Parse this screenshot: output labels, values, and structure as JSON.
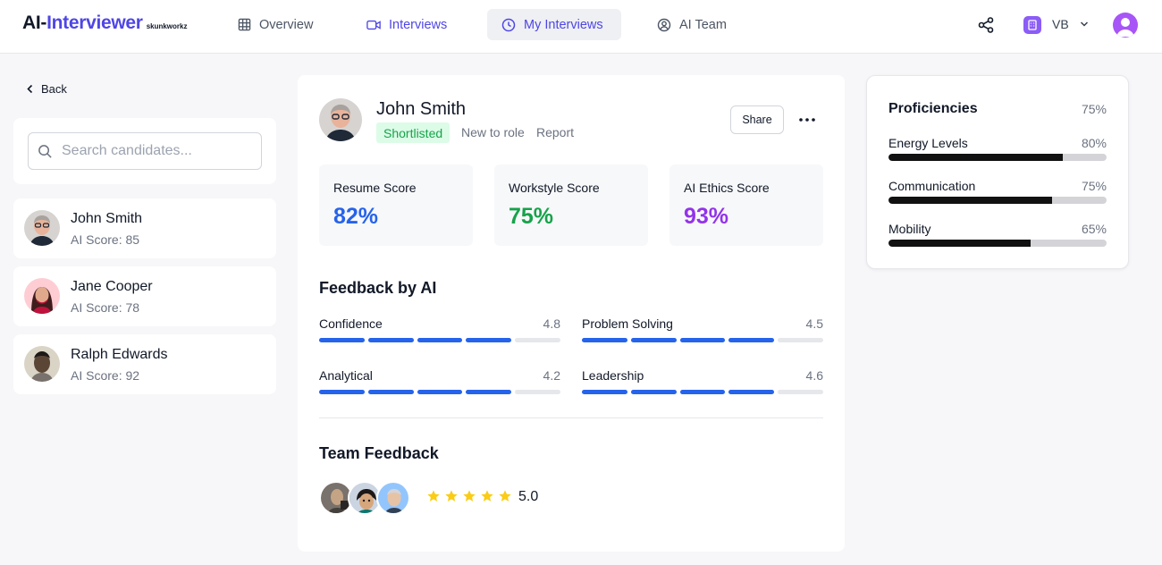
{
  "header": {
    "logo_part1": "AI-",
    "logo_part2": "Interviewer",
    "logo_sub": "skunkworkz",
    "nav": [
      {
        "label": "Overview",
        "icon": "grid-icon"
      },
      {
        "label": "Interviews",
        "icon": "video-icon"
      },
      {
        "label": "My Interviews",
        "icon": "clock-icon"
      },
      {
        "label": "AI Team",
        "icon": "user-circle-icon"
      }
    ],
    "org_label": "VB"
  },
  "sidebar": {
    "back_label": "Back",
    "search_placeholder": "Search candidates...",
    "candidates": [
      {
        "name": "John Smith",
        "score": "AI Score: 85"
      },
      {
        "name": "Jane Cooper",
        "score": "AI Score: 78"
      },
      {
        "name": "Ralph Edwards",
        "score": "AI Score: 92"
      }
    ]
  },
  "candidate": {
    "name": "John Smith",
    "status": "Shortlisted",
    "tag1": "New to role",
    "tag2": "Report",
    "share_label": "Share",
    "scores": [
      {
        "label": "Resume Score",
        "value": "82%",
        "color": "#2563eb"
      },
      {
        "label": "Workstyle Score",
        "value": "75%",
        "color": "#16a34a"
      },
      {
        "label": "AI Ethics Score",
        "value": "93%",
        "color": "#9333ea"
      }
    ],
    "feedback_title": "Feedback by AI",
    "feedback": [
      {
        "label": "Confidence",
        "value": "4.8",
        "filled": 4,
        "total": 5
      },
      {
        "label": "Problem Solving",
        "value": "4.5",
        "filled": 4,
        "total": 5
      },
      {
        "label": "Analytical",
        "value": "4.2",
        "filled": 4,
        "total": 5
      },
      {
        "label": "Leadership",
        "value": "4.6",
        "filled": 4,
        "total": 5
      }
    ],
    "team_title": "Team Feedback",
    "team_rating": "5.0",
    "team_stars": 5
  },
  "proficiencies": {
    "title": "Proficiencies",
    "total": "75%",
    "items": [
      {
        "label": "Energy Levels",
        "value": "80%",
        "level": 0.8
      },
      {
        "label": "Communication",
        "value": "75%",
        "level": 0.75
      },
      {
        "label": "Mobility",
        "value": "65%",
        "level": 0.65
      }
    ]
  },
  "colors": {
    "brand": "#4f46e5",
    "bar_fill": "#2563eb",
    "star": "#facc15",
    "status_green_bg": "#dcfce7",
    "status_green_text": "#16a34a"
  }
}
